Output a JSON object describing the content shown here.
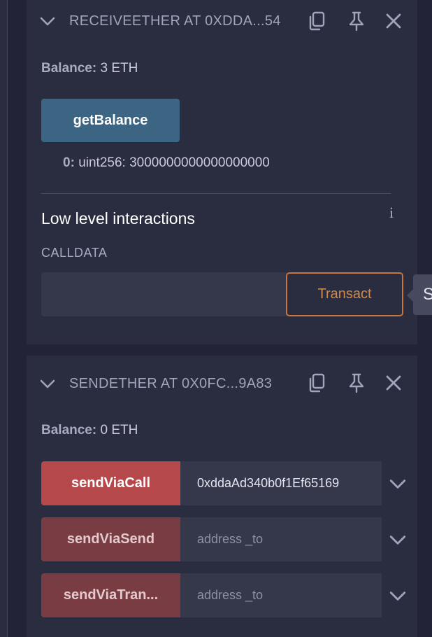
{
  "contracts": [
    {
      "title": "RECEIVEETHER AT 0XDDA...54",
      "balance_label": "Balance:",
      "balance_value": "3 ETH",
      "function_label": "getBalance",
      "result_index": "0:",
      "result_value": "uint256: 3000000000000000000",
      "low_level_title": "Low level interactions",
      "info_symbol": "i",
      "calldata_label": "CALLDATA",
      "calldata_value": "",
      "transact_label": "Transact"
    },
    {
      "title": "SENDETHER AT 0X0FC...9A83",
      "balance_label": "Balance:",
      "balance_value": "0 ETH",
      "functions": [
        {
          "label": "sendViaCall",
          "value": "0xddaAd340b0f1Ef65169",
          "placeholder": "address _to"
        },
        {
          "label": "sendViaSend",
          "value": "",
          "placeholder": "address _to"
        },
        {
          "label": "sendViaTran...",
          "value": "",
          "placeholder": "address _to"
        }
      ]
    }
  ],
  "tooltip_text": "S",
  "icons": [
    "chevron-down-icon",
    "copy-icon",
    "pin-icon",
    "close-icon"
  ],
  "colors": {
    "background": "#222336",
    "panel": "#2a2c3f",
    "call_button": "#3c6583",
    "payable_button": "#b4484a",
    "payable_button_dim": "#7a3c43",
    "transact_border": "#c97539"
  }
}
